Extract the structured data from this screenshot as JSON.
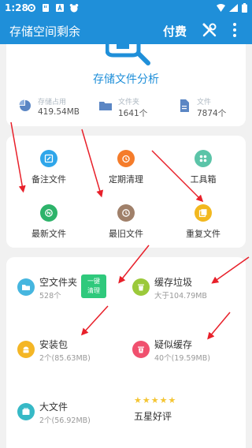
{
  "status_bar": {
    "time": "1:28"
  },
  "app_bar": {
    "title": "存储空间剩余",
    "pay": "付费"
  },
  "analysis": {
    "title": "存储文件分析",
    "stats": [
      {
        "label": "存储占用",
        "value": "419.54MB"
      },
      {
        "label": "文件夹",
        "value": "1641个"
      },
      {
        "label": "文件",
        "value": "7874个"
      }
    ]
  },
  "tools": [
    {
      "label": "备注文件",
      "color": "#2fa6ea"
    },
    {
      "label": "定期清理",
      "color": "#f57c2a"
    },
    {
      "label": "工具箱",
      "color": "#5bc4a8"
    },
    {
      "label": "最新文件",
      "color": "#2db36a"
    },
    {
      "label": "最旧文件",
      "color": "#a0806a"
    },
    {
      "label": "重复文件",
      "color": "#f2b81f"
    }
  ],
  "clean_items": [
    {
      "name": "空文件夹",
      "sub": "528个",
      "color": "#46b6df"
    },
    {
      "name": "缓存垃圾",
      "sub": "大于104.79MB",
      "color": "#9bc93a"
    },
    {
      "name": "安装包",
      "sub": "2个(85.63MB)",
      "color": "#f4b625"
    },
    {
      "name": "疑似缓存",
      "sub": "40个(19.59MB)",
      "color": "#f0506e"
    },
    {
      "name": "大文件",
      "sub": "2个(56.92MB)",
      "color": "#36b9c6"
    }
  ],
  "clean_button": {
    "line1": "一键",
    "line2": "清理"
  },
  "rating": {
    "label": "五星好评",
    "stars": 5
  },
  "arrow_color": "#e8202a"
}
